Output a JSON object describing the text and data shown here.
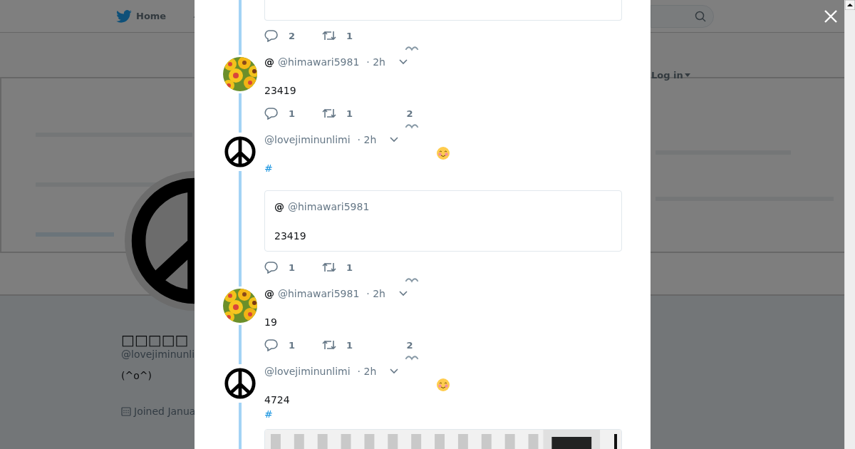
{
  "nav": {
    "home": "Home",
    "login": "Log in"
  },
  "profile": {
    "name": "□□□□□",
    "handle": "@lovejiminunli",
    "bio": "(^o^)",
    "joined": "Joined Janua"
  },
  "thread": {
    "previous": {
      "replies": "2",
      "retweets": "1"
    },
    "tweets": [
      {
        "name": "@",
        "handle": "@himawari5981",
        "time": "· 2h",
        "emoji": false,
        "text": "23419",
        "replies": "1",
        "retweets": "1",
        "likes": "2"
      },
      {
        "kind": "peace",
        "handle": "@lovejiminunlimi",
        "time": "· 2h",
        "emoji": true,
        "hashtag": "#",
        "quote": {
          "name": "@",
          "handle": "@himawari5981",
          "text": "23419"
        },
        "replies": "1",
        "retweets": "1"
      },
      {
        "name": "@",
        "handle": "@himawari5981",
        "time": "· 2h",
        "emoji": false,
        "text": "19",
        "replies": "1",
        "retweets": "1",
        "likes": "2"
      },
      {
        "kind": "peace",
        "handle": "@lovejiminunlimi",
        "time": "· 2h",
        "emoji": true,
        "text": "4724",
        "hashtag": "#"
      }
    ]
  }
}
